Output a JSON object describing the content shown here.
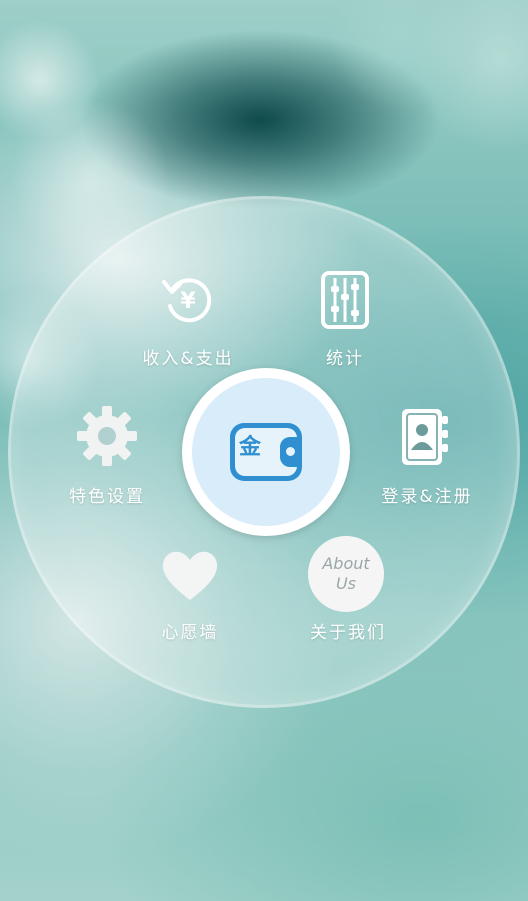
{
  "menu": {
    "center_glyph": "金",
    "items": [
      {
        "id": "income",
        "label": "收入&支出",
        "icon": "refresh-yuan-icon"
      },
      {
        "id": "stats",
        "label": "统计",
        "icon": "abacus-icon"
      },
      {
        "id": "settings",
        "label": "特色设置",
        "icon": "gear-icon"
      },
      {
        "id": "login",
        "label": "登录&注册",
        "icon": "contacts-book-icon"
      },
      {
        "id": "wish",
        "label": "心愿墙",
        "icon": "heart-icon"
      },
      {
        "id": "about",
        "label": "关于我们",
        "icon": "about-us-icon",
        "icon_text_line1": "About",
        "icon_text_line2": "Us"
      }
    ]
  },
  "colors": {
    "accent": "#2f8fd0",
    "center_fill": "#d8ecfa",
    "label": "#ffffff"
  }
}
